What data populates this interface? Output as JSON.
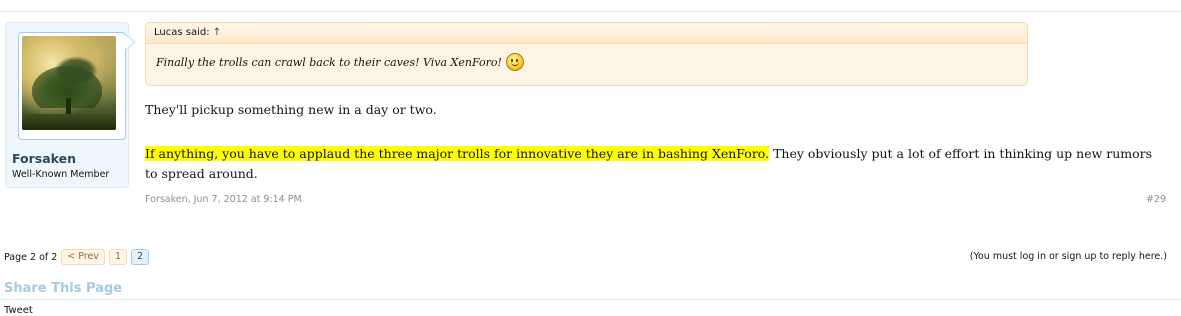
{
  "post": {
    "username": "Forsaken",
    "user_title": "Well-Known Member",
    "quote": {
      "header": "Lucas said:",
      "arrow": "↑",
      "text": "Finally the trolls can crawl back to their caves! Viva XenForo!",
      "smiley_icon": "smile-emoji"
    },
    "paragraph1": "They'll pickup something new in a day or two.",
    "paragraph2_highlight": "If anything, you have to applaud the three major trolls for innovative they are in bashing XenForo.",
    "paragraph2_rest": " They obviously put a lot of effort in thinking up new rumors to spread around.",
    "meta": "Forsaken, Jun 7, 2012 at 9:14 PM",
    "number": "#29",
    "highlight_color": "#ffff00"
  },
  "pagination": {
    "label": "Page 2 of 2",
    "prev": "< Prev",
    "pages": [
      "1",
      "2"
    ],
    "current": "2"
  },
  "login_note": "(You must log in or sign up to reply here.)",
  "share": {
    "title": "Share This Page",
    "tweet": "Tweet"
  }
}
